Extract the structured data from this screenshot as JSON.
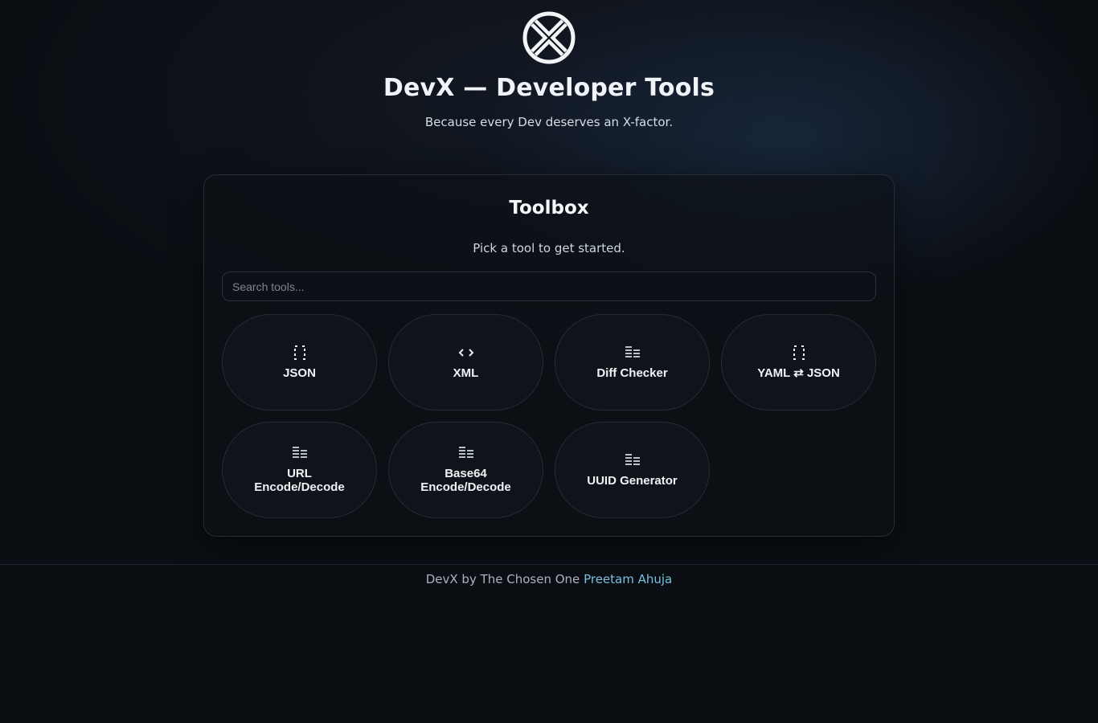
{
  "header": {
    "logo_icon": "x-circle-icon",
    "title": "DevX — Developer Tools",
    "tagline": "Because every Dev deserves an X-factor."
  },
  "toolbox": {
    "title": "Toolbox",
    "subtitle": "Pick a tool to get started.",
    "search": {
      "placeholder": "Search tools...",
      "value": ""
    },
    "tools": [
      {
        "label": "JSON",
        "icon": "braces-icon"
      },
      {
        "label": "XML",
        "icon": "code-brackets-icon"
      },
      {
        "label": "Diff Checker",
        "icon": "list-icon"
      },
      {
        "label": "YAML ⇄ JSON",
        "icon": "braces-icon"
      },
      {
        "label": "URL Encode/Decode",
        "icon": "list-icon"
      },
      {
        "label": "Base64 Encode/Decode",
        "icon": "list-icon"
      },
      {
        "label": "UUID Generator",
        "icon": "list-icon"
      }
    ]
  },
  "footer": {
    "text": "DevX by The Chosen One",
    "author_link": "Preetam Ahuja"
  },
  "colors": {
    "background": "#0b0e13",
    "card": "#0f141b",
    "accent_link": "#79c0e0"
  }
}
